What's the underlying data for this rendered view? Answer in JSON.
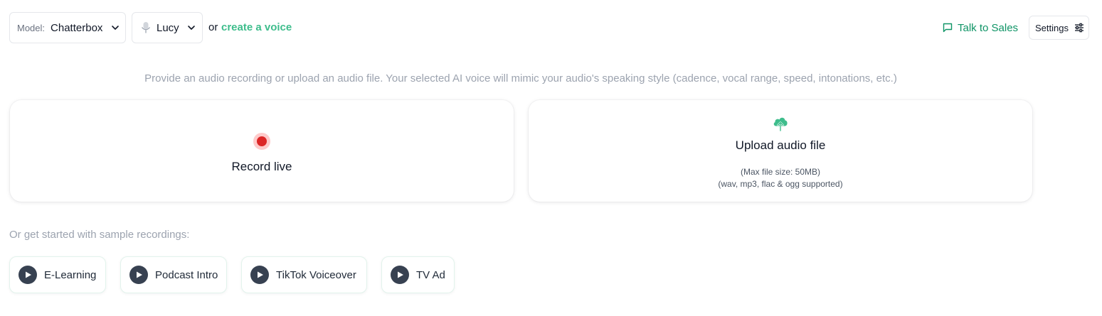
{
  "header": {
    "model_label": "Model:",
    "model_value": "Chatterbox",
    "voice_value": "Lucy",
    "or_text": "or",
    "create_voice_link": "create a voice",
    "talk_to_sales": "Talk to Sales",
    "settings_label": "Settings"
  },
  "main": {
    "intro": "Provide an audio recording or upload an audio file. Your selected AI voice will mimic your audio's speaking style (cadence, vocal range, speed, intonations, etc.)",
    "record_title": "Record live",
    "upload_title": "Upload audio file",
    "upload_max": "(Max file size: 50MB)",
    "upload_formats": "(wav, mp3, flac & ogg supported)"
  },
  "samples": {
    "label": "Or get started with sample recordings:",
    "items": [
      {
        "label": "E-Learning"
      },
      {
        "label": "Podcast Intro"
      },
      {
        "label": "TikTok Voiceover"
      },
      {
        "label": "TV Ad"
      }
    ]
  },
  "colors": {
    "accent": "#3ebd8c",
    "talk_sales": "#0f9466",
    "record": "#dc2626"
  },
  "icons": [
    "chevron-down-icon",
    "microphone-icon",
    "chat-icon",
    "sliders-icon",
    "cloud-upload-icon",
    "record-icon",
    "play-icon"
  ]
}
